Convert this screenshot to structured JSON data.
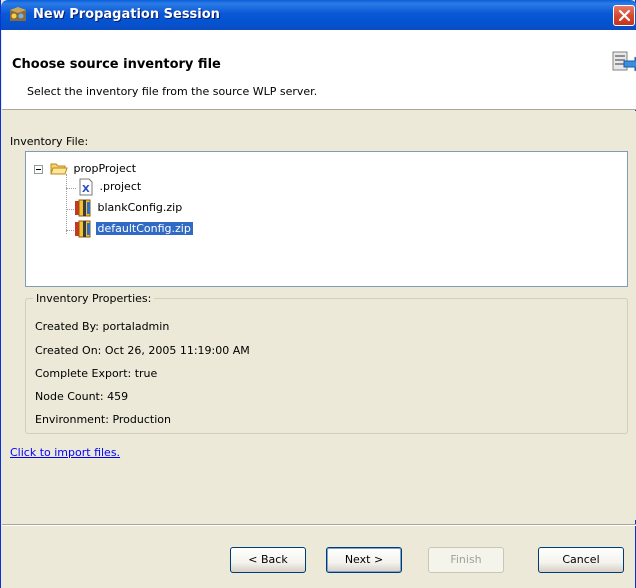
{
  "window": {
    "title": "New Propagation Session"
  },
  "header": {
    "title": "Choose source inventory file",
    "description": "Select the inventory file from the source WLP server."
  },
  "inventory": {
    "label": "Inventory File:",
    "tree": {
      "root": "propProject",
      "children": [
        {
          "label": ".project",
          "icon": "xml-file-icon"
        },
        {
          "label": "blankConfig.zip",
          "icon": "zip-archive-icon"
        },
        {
          "label": "defaultConfig.zip",
          "icon": "zip-archive-icon",
          "selected": true
        }
      ]
    }
  },
  "properties": {
    "legend": "Inventory Properties:",
    "created_by": "Created By: portaladmin",
    "created_on": "Created On: Oct 26, 2005 11:19:00 AM",
    "complete_export": "Complete Export: true",
    "node_count": "Node Count: 459",
    "environment": "Environment: Production"
  },
  "import_link": "Click to import files.",
  "buttons": {
    "back": "< Back",
    "next": "Next >",
    "finish": "Finish",
    "cancel": "Cancel"
  },
  "colors": {
    "titlebar": "#0a58d6",
    "selection": "#316ac5",
    "link": "#0000ff"
  }
}
